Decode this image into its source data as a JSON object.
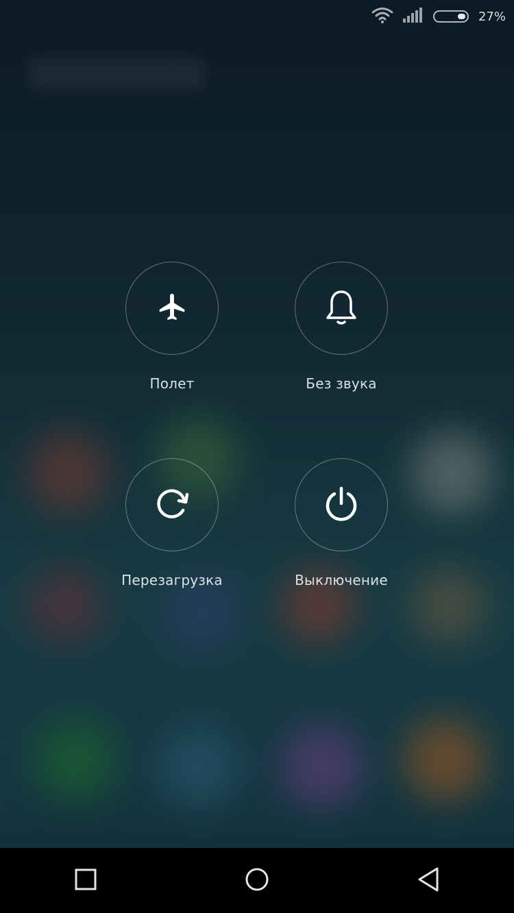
{
  "status_bar": {
    "battery_text": "27%",
    "battery_level": 0.27,
    "icons": [
      "wifi-icon",
      "signal-icon",
      "battery-icon"
    ]
  },
  "power_menu": {
    "actions": [
      {
        "id": "airplane",
        "icon": "airplane-icon",
        "label": "Полет"
      },
      {
        "id": "silent",
        "icon": "bell-icon",
        "label": "Без звука"
      },
      {
        "id": "reboot",
        "icon": "refresh-icon",
        "label": "Перезагрузка"
      },
      {
        "id": "power_off",
        "icon": "power-icon",
        "label": "Выключение"
      }
    ]
  },
  "nav_bar": {
    "buttons": [
      "recent-apps-icon",
      "home-icon",
      "back-icon"
    ]
  },
  "colors": {
    "circle_border": "#ffffff59",
    "label": "#d9e2e5",
    "nav_bg": "#000000"
  }
}
